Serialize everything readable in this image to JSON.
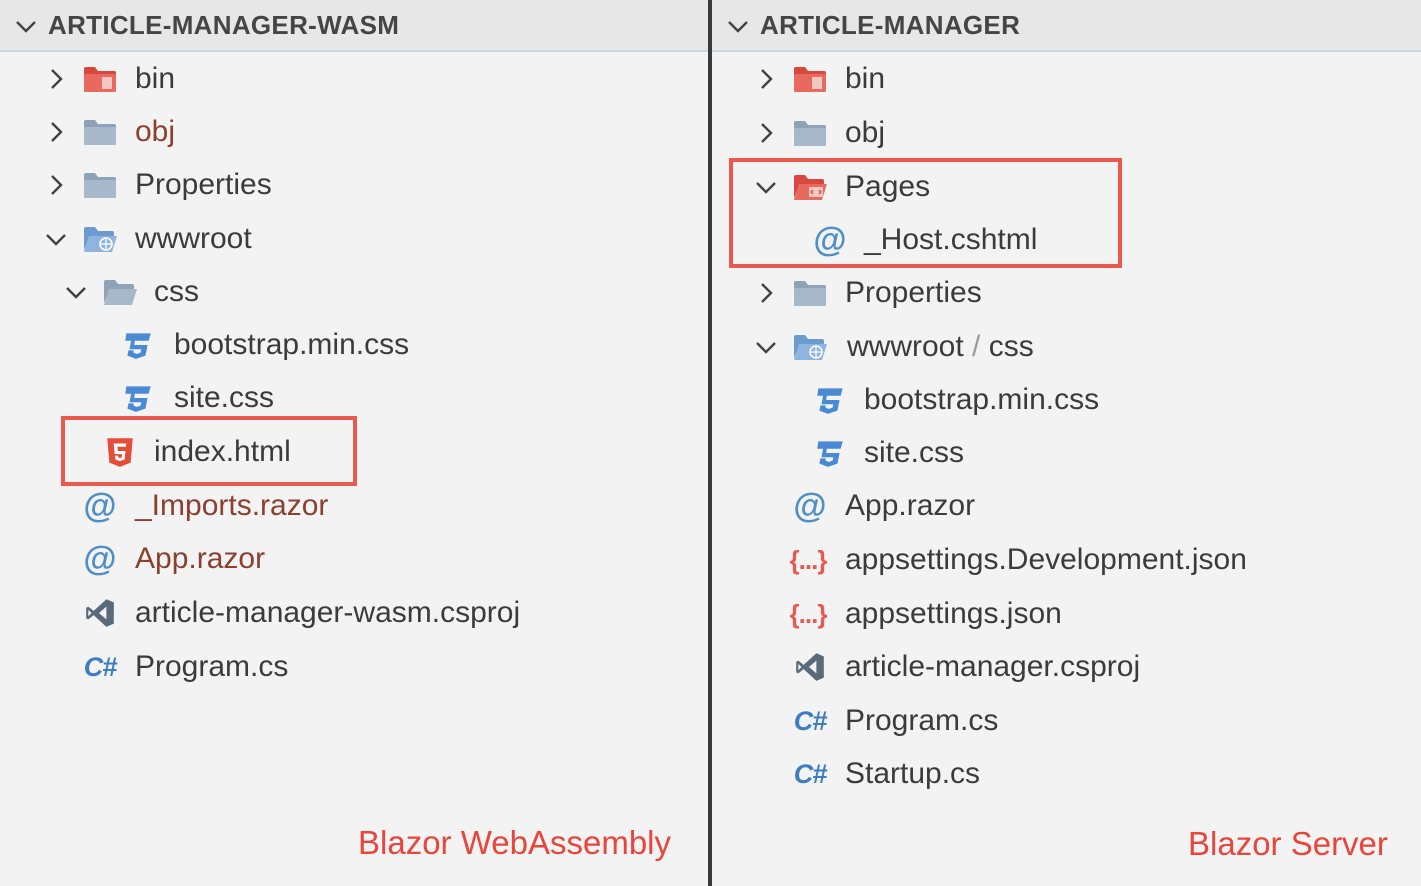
{
  "left": {
    "header": "ARTICLE-MANAGER-WASM",
    "items": [
      {
        "label": "bin"
      },
      {
        "label": "obj"
      },
      {
        "label": "Properties"
      },
      {
        "label": "wwwroot"
      },
      {
        "label": "css"
      },
      {
        "label": "bootstrap.min.css"
      },
      {
        "label": "site.css"
      },
      {
        "label": "index.html"
      },
      {
        "label": "_Imports.razor"
      },
      {
        "label": "App.razor"
      },
      {
        "label": "article-manager-wasm.csproj"
      },
      {
        "label": "Program.cs"
      }
    ],
    "caption": "Blazor WebAssembly"
  },
  "right": {
    "header": "ARTICLE-MANAGER",
    "items": [
      {
        "label": "bin"
      },
      {
        "label": "obj"
      },
      {
        "label": "Pages"
      },
      {
        "label": "_Host.cshtml"
      },
      {
        "label": "Properties"
      },
      {
        "label": "wwwroot",
        "sep": "/",
        "label2": "css"
      },
      {
        "label": "bootstrap.min.css"
      },
      {
        "label": "site.css"
      },
      {
        "label": "App.razor"
      },
      {
        "label": "appsettings.Development.json"
      },
      {
        "label": "appsettings.json"
      },
      {
        "label": "article-manager.csproj"
      },
      {
        "label": "Program.cs"
      },
      {
        "label": "Startup.cs"
      }
    ],
    "caption": "Blazor Server"
  },
  "icons": {
    "at": "@",
    "csharp": "C#",
    "json": "{...}"
  },
  "colors": {
    "highlight": "#e85a4f",
    "caption": "#e8453c",
    "modified_text": "#8b3f2f",
    "folder": "#8fa3b8",
    "folder_special": "#e0594c",
    "css_icon": "#4a8ad4"
  }
}
